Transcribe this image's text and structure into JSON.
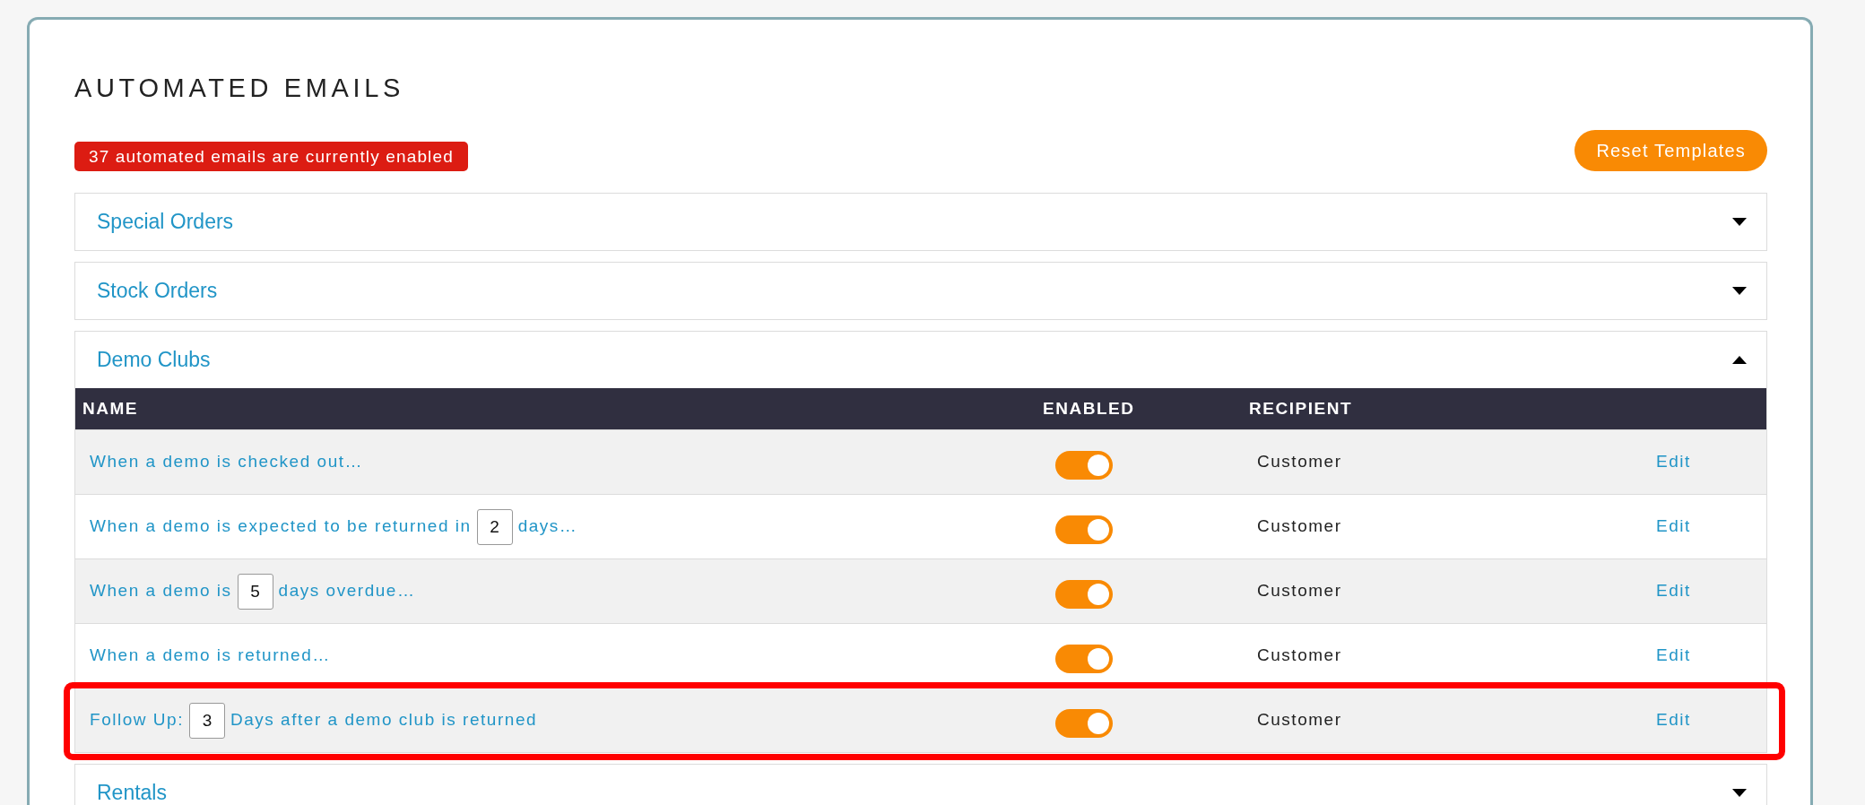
{
  "title": "AUTOMATED EMAILS",
  "status_badge": "37 automated emails are currently enabled",
  "reset_button": "Reset Templates",
  "sections": [
    {
      "title": "Special Orders",
      "expanded": false
    },
    {
      "title": "Stock Orders",
      "expanded": false
    },
    {
      "title": "Demo Clubs",
      "expanded": true,
      "table": {
        "columns": [
          "NAME",
          "ENABLED",
          "RECIPIENT"
        ],
        "rows": [
          {
            "name_parts": [
              {
                "kind": "text",
                "text": "When a demo is checked out…"
              }
            ],
            "enabled": true,
            "recipient": "Customer",
            "action": "Edit",
            "highlighted": false
          },
          {
            "name_parts": [
              {
                "kind": "text",
                "text": "When a demo is expected to be returned in"
              },
              {
                "kind": "input",
                "text": "2"
              },
              {
                "kind": "text",
                "text": "days…"
              }
            ],
            "enabled": true,
            "recipient": "Customer",
            "action": "Edit",
            "highlighted": false
          },
          {
            "name_parts": [
              {
                "kind": "text",
                "text": "When a demo is"
              },
              {
                "kind": "input",
                "text": "5"
              },
              {
                "kind": "text",
                "text": "days overdue…"
              }
            ],
            "enabled": true,
            "recipient": "Customer",
            "action": "Edit",
            "highlighted": false
          },
          {
            "name_parts": [
              {
                "kind": "text",
                "text": "When a demo is returned…"
              }
            ],
            "enabled": true,
            "recipient": "Customer",
            "action": "Edit",
            "highlighted": false
          },
          {
            "name_parts": [
              {
                "kind": "text",
                "text": "Follow Up:"
              },
              {
                "kind": "input",
                "text": "3"
              },
              {
                "kind": "text",
                "text": "Days after a demo club is returned"
              }
            ],
            "enabled": true,
            "recipient": "Customer",
            "action": "Edit",
            "highlighted": true
          }
        ]
      }
    },
    {
      "title": "Rentals",
      "expanded": false
    }
  ]
}
